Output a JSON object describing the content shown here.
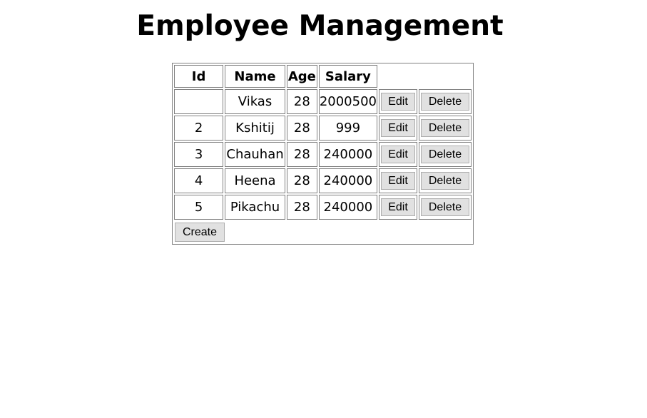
{
  "title": "Employee Management",
  "table": {
    "headers": [
      "Id",
      "Name",
      "Age",
      "Salary"
    ],
    "rows": [
      {
        "id": "",
        "name": "Vikas",
        "age": "28",
        "salary": "2000500"
      },
      {
        "id": "2",
        "name": "Kshitij",
        "age": "28",
        "salary": "999"
      },
      {
        "id": "3",
        "name": "Chauhan",
        "age": "28",
        "salary": "240000"
      },
      {
        "id": "4",
        "name": "Heena",
        "age": "28",
        "salary": "240000"
      },
      {
        "id": "5",
        "name": "Pikachu",
        "age": "28",
        "salary": "240000"
      }
    ],
    "edit_label": "Edit",
    "delete_label": "Delete",
    "create_label": "Create"
  }
}
